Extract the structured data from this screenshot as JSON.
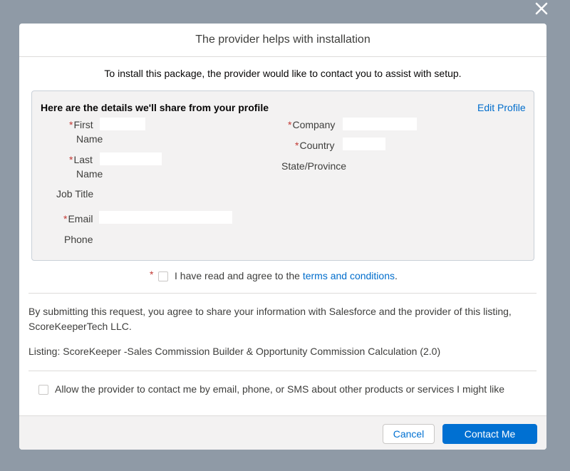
{
  "modal": {
    "title": "The provider helps with installation",
    "intro": "To install this package, the provider would like to contact you to assist with setup."
  },
  "profile": {
    "heading": "Here are the details we'll share from your profile",
    "edit_link": "Edit Profile",
    "required_marker": "*",
    "fields": {
      "first_name_l1": "First",
      "first_name_l2": "Name",
      "last_name_l1": "Last",
      "last_name_l2": "Name",
      "job_title": "Job Title",
      "email": "Email",
      "phone": "Phone",
      "company": "Company",
      "country": "Country",
      "state_province": "State/Province"
    }
  },
  "agreement": {
    "required_marker": "*",
    "text_before": "I have read and agree to the ",
    "link_text": "terms and conditions",
    "text_after": "."
  },
  "disclaimer": "By submitting this request, you agree to share your information with Salesforce and the provider of this listing, ScoreKeeperTech LLC.",
  "listing": "Listing: ScoreKeeper -Sales Commission Builder & Opportunity Commission Calculation (2.0)",
  "optin": "Allow the provider to contact me by email, phone, or SMS about other products or services I might like",
  "footer": {
    "cancel_label": "Cancel",
    "contact_label": "Contact Me"
  },
  "colors": {
    "backdrop": "#8f9aa6",
    "brand": "#0070d2",
    "link": "#006dcc",
    "required": "#c23934",
    "panel_bg": "#f3f2f2"
  },
  "icons": {
    "close": "close-icon"
  }
}
